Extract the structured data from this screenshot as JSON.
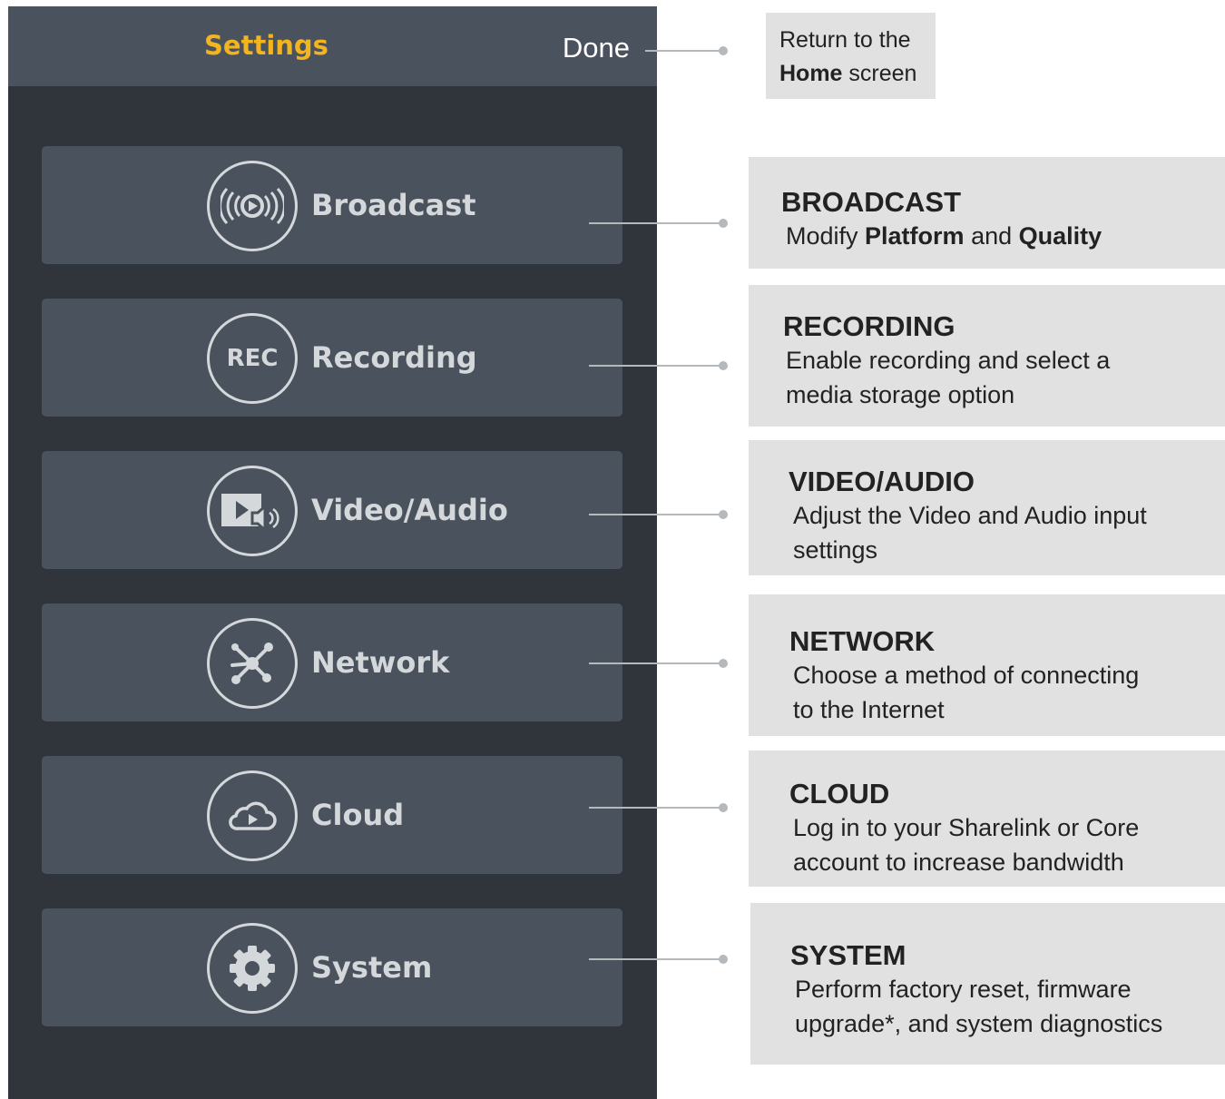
{
  "header": {
    "title": "Settings",
    "done_label": "Done"
  },
  "menu": [
    {
      "label": "Broadcast",
      "icon": "broadcast-icon"
    },
    {
      "label": "Recording",
      "icon": "rec-icon",
      "icon_text": "REC"
    },
    {
      "label": "Video/Audio",
      "icon": "video-audio-icon"
    },
    {
      "label": "Network",
      "icon": "network-icon"
    },
    {
      "label": "Cloud",
      "icon": "cloud-icon"
    },
    {
      "label": "System",
      "icon": "gear-icon"
    }
  ],
  "callouts": {
    "done": {
      "line1": "Return to the",
      "line2_bold": "Home",
      "line2_rest": " screen"
    },
    "broadcast": {
      "title": "BROADCAST",
      "prefix": "Modify ",
      "bold1": "Platform",
      "mid": " and ",
      "bold2": "Quality"
    },
    "recording": {
      "title": "RECORDING",
      "line1": "Enable recording and select a",
      "line2": "media storage option"
    },
    "video_audio": {
      "title": "VIDEO/AUDIO",
      "line1": "Adjust the Video and Audio input",
      "line2": "settings"
    },
    "network": {
      "title": "NETWORK",
      "line1": "Choose a method of connecting",
      "line2": "to the Internet"
    },
    "cloud": {
      "title": "CLOUD",
      "line1": "Log in to your Sharelink or Core",
      "line2": "account to increase bandwidth"
    },
    "system": {
      "title": "SYSTEM",
      "line1": "Perform factory reset, firmware",
      "line2": "upgrade*, and system diagnostics"
    }
  },
  "colors": {
    "screen_bg": "#30353b",
    "bar_bg": "#4a525d",
    "title_accent": "#f2b51f",
    "callout_bg": "#e1e1e1"
  }
}
